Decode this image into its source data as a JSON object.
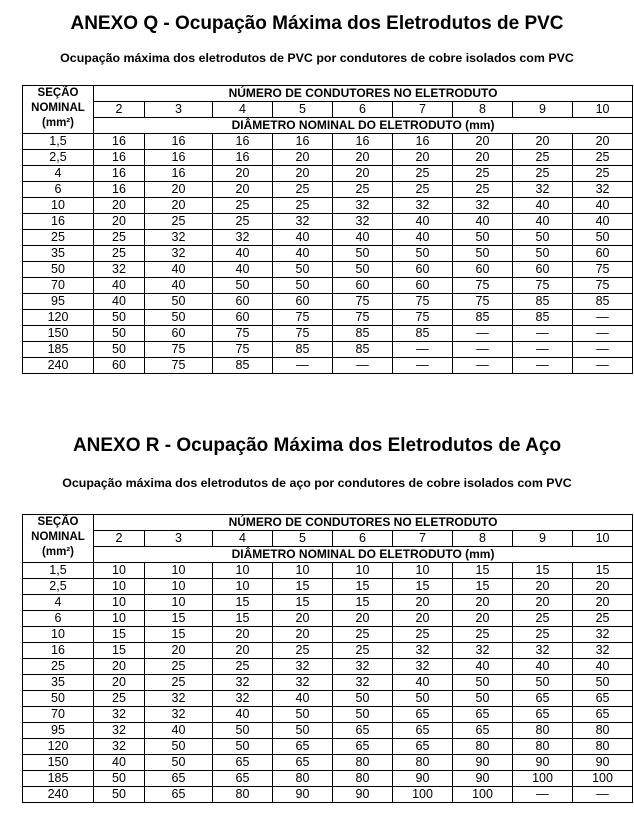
{
  "annex_q": {
    "title": "ANEXO Q - Ocupação Máxima dos Eletrodutos de PVC",
    "subtitle": "Ocupação máxima dos eletrodutos de PVC por condutores de cobre isolados com PVC",
    "header_secao": [
      "SEÇÃO",
      "NOMINAL",
      "(mm²)"
    ],
    "header_numero": "NÚMERO DE CONDUTORES NO ELETRODUTO",
    "header_diametro": "DIÂMETRO NOMINAL DO ELETRODUTO (mm)",
    "conductor_counts": [
      "2",
      "3",
      "4",
      "5",
      "6",
      "7",
      "8",
      "9",
      "10"
    ],
    "rows": [
      [
        "1,5",
        "16",
        "16",
        "16",
        "16",
        "16",
        "16",
        "20",
        "20",
        "20"
      ],
      [
        "2,5",
        "16",
        "16",
        "16",
        "20",
        "20",
        "20",
        "20",
        "25",
        "25"
      ],
      [
        "4",
        "16",
        "16",
        "20",
        "20",
        "20",
        "25",
        "25",
        "25",
        "25"
      ],
      [
        "6",
        "16",
        "20",
        "20",
        "25",
        "25",
        "25",
        "25",
        "32",
        "32"
      ],
      [
        "10",
        "20",
        "20",
        "25",
        "25",
        "32",
        "32",
        "32",
        "40",
        "40"
      ],
      [
        "16",
        "20",
        "25",
        "25",
        "32",
        "32",
        "40",
        "40",
        "40",
        "40"
      ],
      [
        "25",
        "25",
        "32",
        "32",
        "40",
        "40",
        "40",
        "50",
        "50",
        "50"
      ],
      [
        "35",
        "25",
        "32",
        "40",
        "40",
        "50",
        "50",
        "50",
        "50",
        "60"
      ],
      [
        "50",
        "32",
        "40",
        "40",
        "50",
        "50",
        "60",
        "60",
        "60",
        "75"
      ],
      [
        "70",
        "40",
        "40",
        "50",
        "50",
        "60",
        "60",
        "75",
        "75",
        "75"
      ],
      [
        "95",
        "40",
        "50",
        "60",
        "60",
        "75",
        "75",
        "75",
        "85",
        "85"
      ],
      [
        "120",
        "50",
        "50",
        "60",
        "75",
        "75",
        "75",
        "85",
        "85",
        "—"
      ],
      [
        "150",
        "50",
        "60",
        "75",
        "75",
        "85",
        "85",
        "—",
        "—",
        "—"
      ],
      [
        "185",
        "50",
        "75",
        "75",
        "85",
        "85",
        "—",
        "—",
        "—",
        "—"
      ],
      [
        "240",
        "60",
        "75",
        "85",
        "—",
        "—",
        "—",
        "—",
        "—",
        "—"
      ]
    ]
  },
  "annex_r": {
    "title": "ANEXO R - Ocupação Máxima dos Eletrodutos de Aço",
    "subtitle": "Ocupação máxima dos eletrodutos de aço por condutores de cobre isolados com PVC",
    "header_secao": [
      "SEÇÃO",
      "NOMINAL",
      "(mm²)"
    ],
    "header_numero": "NÚMERO DE CONDUTORES NO ELETRODUTO",
    "header_diametro": "DIÂMETRO NOMINAL DO ELETRODUTO (mm)",
    "conductor_counts": [
      "2",
      "3",
      "4",
      "5",
      "6",
      "7",
      "8",
      "9",
      "10"
    ],
    "rows": [
      [
        "1,5",
        "10",
        "10",
        "10",
        "10",
        "10",
        "10",
        "15",
        "15",
        "15"
      ],
      [
        "2,5",
        "10",
        "10",
        "10",
        "15",
        "15",
        "15",
        "15",
        "20",
        "20"
      ],
      [
        "4",
        "10",
        "10",
        "15",
        "15",
        "15",
        "20",
        "20",
        "20",
        "20"
      ],
      [
        "6",
        "10",
        "15",
        "15",
        "20",
        "20",
        "20",
        "20",
        "25",
        "25"
      ],
      [
        "10",
        "15",
        "15",
        "20",
        "20",
        "25",
        "25",
        "25",
        "25",
        "32"
      ],
      [
        "16",
        "15",
        "20",
        "20",
        "25",
        "25",
        "32",
        "32",
        "32",
        "32"
      ],
      [
        "25",
        "20",
        "25",
        "25",
        "32",
        "32",
        "32",
        "40",
        "40",
        "40"
      ],
      [
        "35",
        "20",
        "25",
        "32",
        "32",
        "32",
        "40",
        "50",
        "50",
        "50"
      ],
      [
        "50",
        "25",
        "32",
        "32",
        "40",
        "50",
        "50",
        "50",
        "65",
        "65"
      ],
      [
        "70",
        "32",
        "32",
        "40",
        "50",
        "50",
        "65",
        "65",
        "65",
        "65"
      ],
      [
        "95",
        "32",
        "40",
        "50",
        "50",
        "65",
        "65",
        "65",
        "80",
        "80"
      ],
      [
        "120",
        "32",
        "50",
        "50",
        "65",
        "65",
        "65",
        "80",
        "80",
        "80"
      ],
      [
        "150",
        "40",
        "50",
        "65",
        "65",
        "80",
        "80",
        "90",
        "90",
        "90"
      ],
      [
        "185",
        "50",
        "65",
        "65",
        "80",
        "80",
        "90",
        "90",
        "100",
        "100"
      ],
      [
        "240",
        "50",
        "65",
        "80",
        "90",
        "90",
        "100",
        "100",
        "—",
        "—"
      ]
    ]
  }
}
